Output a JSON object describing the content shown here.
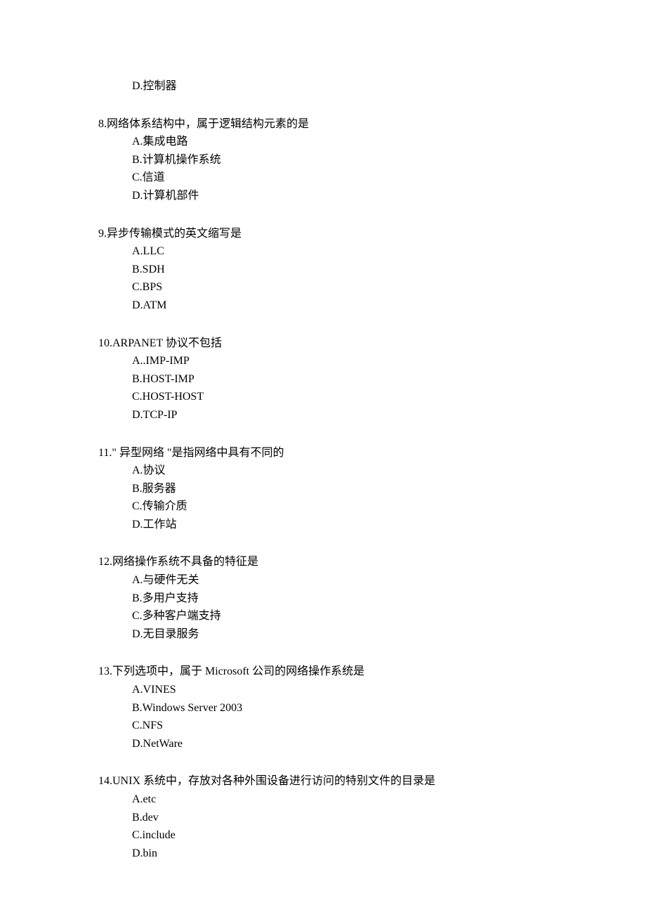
{
  "orphan": {
    "label": "D.控制器"
  },
  "questions": [
    {
      "number": "8.",
      "stem": "网络体系结构中，属于逻辑结构元素的是",
      "options": [
        "A.集成电路",
        "B.计算机操作系统",
        "C.信道",
        "D.计算机部件"
      ]
    },
    {
      "number": "9.",
      "stem": "异步传输模式的英文缩写是",
      "options": [
        "A.LLC",
        "B.SDH",
        "C.BPS",
        "D.ATM"
      ]
    },
    {
      "number": "10.",
      "stem": "ARPANET 协议不包括",
      "options": [
        "A..IMP-IMP",
        "B.HOST-IMP",
        "C.HOST-HOST",
        "D.TCP-IP"
      ]
    },
    {
      "number": "11.",
      "stem": "\" 异型网络 \"是指网络中具有不同的",
      "options": [
        "A.协议",
        "B.服务器",
        "C.传输介质",
        "D.工作站"
      ]
    },
    {
      "number": "12.",
      "stem": "网络操作系统不具备的特征是",
      "options": [
        "A.与硬件无关",
        "B.多用户支持",
        "C.多种客户端支持",
        "D.无目录服务"
      ]
    },
    {
      "number": "13.",
      "stem": "下列选项中，属于 Microsoft 公司的网络操作系统是",
      "options": [
        "A.VINES",
        "B.Windows Server 2003",
        "C.NFS",
        "D.NetWare"
      ]
    },
    {
      "number": "14.",
      "stem": "UNIX 系统中，存放对各种外围设备进行访问的特别文件的目录是",
      "options": [
        "A.etc",
        "B.dev",
        "C.include",
        "D.bin"
      ]
    }
  ]
}
